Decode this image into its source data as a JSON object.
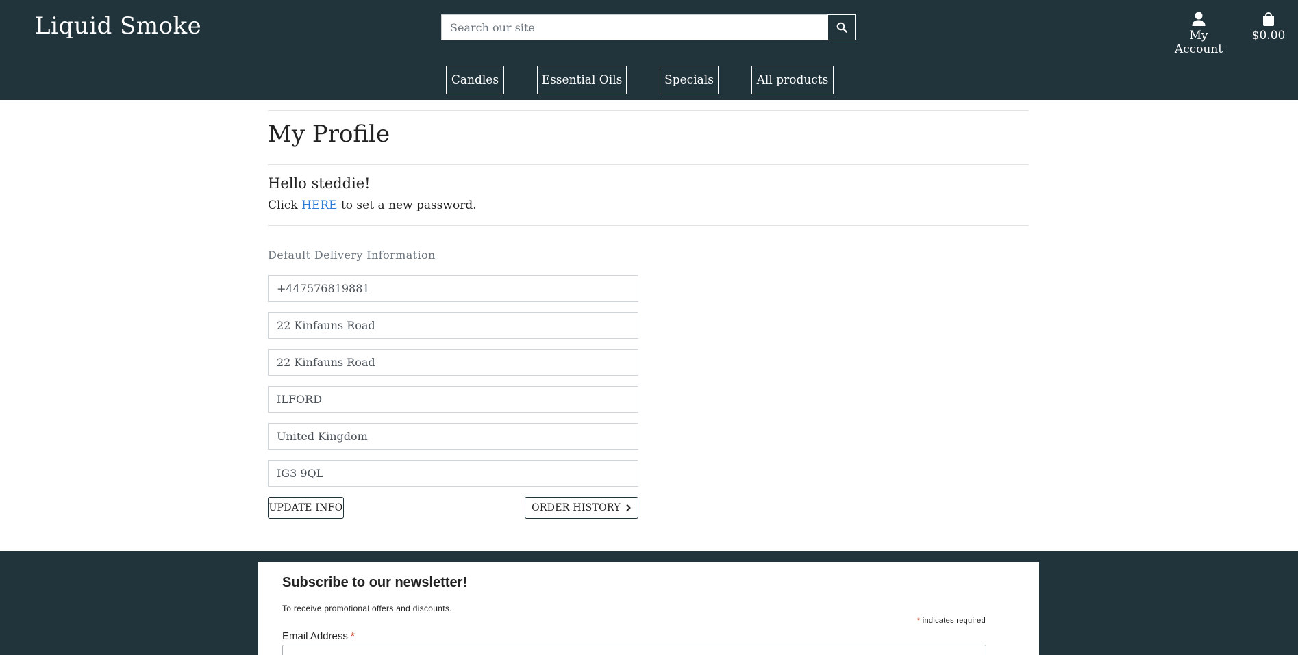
{
  "header": {
    "brand": "Liquid Smoke",
    "search_placeholder": "Search our site",
    "account_label": "My Account",
    "cart_total": "$0.00"
  },
  "nav": {
    "items": [
      "Candles",
      "Essential Oils",
      "Specials",
      "All products"
    ]
  },
  "profile": {
    "title": "My Profile",
    "greeting": "Hello steddie!",
    "password_prefix": "Click ",
    "password_link": "HERE",
    "password_suffix": " to set a new password.",
    "section_label": "Default Delivery Information",
    "fields": {
      "phone": "+447576819881",
      "address1": "22 Kinfauns Road",
      "address2": "22 Kinfauns Road",
      "town": "ILFORD",
      "country": "United Kingdom",
      "postcode": "IG3 9QL"
    },
    "update_button": "UPDATE INFO",
    "order_history_button": "ORDER HISTORY"
  },
  "newsletter": {
    "title": "Subscribe to our newsletter!",
    "subtitle": "To receive promotional offers and discounts.",
    "required_asterisk": "*",
    "required_note": " indicates required",
    "email_label": "Email Address",
    "email_asterisk": "*"
  },
  "colors": {
    "header_bg": "#21333b",
    "link": "#2e7bd6",
    "required": "#c02b0a"
  }
}
